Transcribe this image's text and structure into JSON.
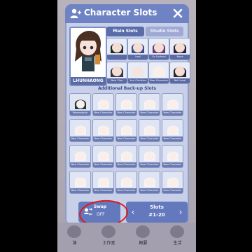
{
  "header": {
    "title": "Character Slots"
  },
  "tabs": [
    {
      "label": "Main Slots"
    },
    {
      "label": "Studio Slots"
    }
  ],
  "current_character": {
    "name": "LHUNHAONG"
  },
  "main_slots": [
    "",
    "Leaf",
    "Oc Fushimi",
    "Nova",
    "New Char",
    "Yuvi Christian",
    "New Character",
    "Nell Loral"
  ],
  "backup": {
    "title": "Additional Back-up Slots",
    "slots": [
      "Nerrosolaria",
      "New Character",
      "New Character",
      "New Character",
      "New Character",
      "New Character",
      "New Character",
      "New Character",
      "New Character",
      "New Character",
      "New Character",
      "New Character",
      "New Character",
      "New Character",
      "New Character",
      "New Character",
      "New Character",
      "New Character",
      "New Character",
      "New Character"
    ]
  },
  "swap": {
    "label": "Swap",
    "state": "OFF"
  },
  "slots_nav": {
    "label": "Slots",
    "range": "#1-20",
    "prev": "‹",
    "next": "›"
  },
  "bottom_nav": [
    {
      "label": "演"
    },
    {
      "label": "工作室"
    },
    {
      "label": "概要"
    },
    {
      "label": "生活"
    }
  ],
  "colors": {
    "header": "#6f83c4",
    "panel": "#c7d0e8",
    "highlight_circle": "#e01818"
  }
}
